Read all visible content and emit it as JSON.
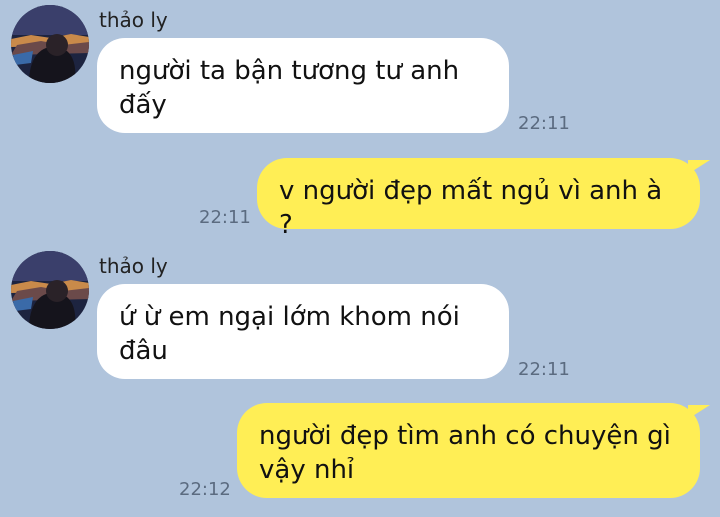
{
  "messages": [
    {
      "direction": "incoming",
      "sender": "thảo ly",
      "text": "người ta bận tương tư anh đấy",
      "time": "22:11"
    },
    {
      "direction": "outgoing",
      "text": "v người đẹp mất ngủ vì anh à ?",
      "time": "22:11"
    },
    {
      "direction": "incoming",
      "sender": "thảo ly",
      "text": "ứ ừ em ngại lớm khom nói đâu",
      "time": "22:11"
    },
    {
      "direction": "outgoing",
      "text": "người đẹp tìm anh có chuyện gì vậy nhỉ",
      "time": "22:12"
    }
  ],
  "avatar_icon": "profile-photo-night-city"
}
